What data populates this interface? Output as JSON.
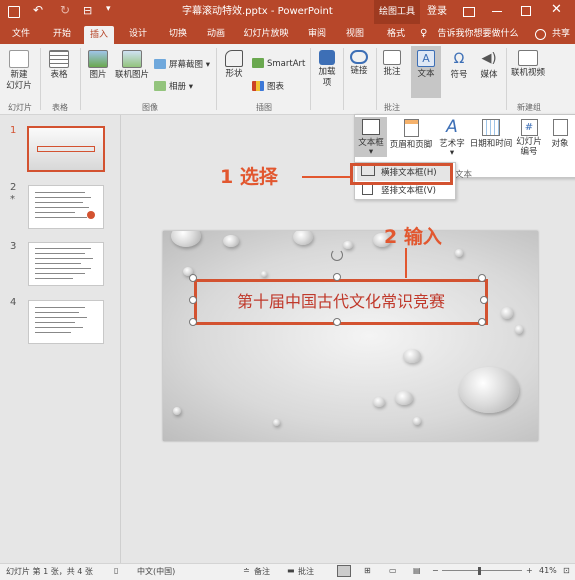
{
  "titlebar": {
    "doc_title": "字幕滚动特效.pptx - PowerPoint",
    "context_tab": "绘图工具",
    "login": "登录"
  },
  "tabs": {
    "file": "文件",
    "home": "开始",
    "insert": "插入",
    "design": "设计",
    "transitions": "切换",
    "animations": "动画",
    "slideshow": "幻灯片放映",
    "review": "审阅",
    "view": "视图",
    "format": "格式",
    "tellme": "告诉我你想要做什么",
    "share": "共享"
  },
  "ribbon": {
    "new_slide": "新建\n幻灯片",
    "table": "表格",
    "picture": "图片",
    "online_picture": "联机图片",
    "screenshot": "屏幕截图",
    "album": "相册",
    "shapes": "形状",
    "smartart": "SmartArt",
    "chart": "图表",
    "addins": "加载\n项",
    "link": "链接",
    "comment": "批注",
    "text": "文本",
    "symbols": "符号",
    "media": "媒体",
    "online_video": "联机视频",
    "groups": {
      "slides": "幻灯片",
      "tables": "表格",
      "images": "图像",
      "illustrations": "插图",
      "comments": "批注",
      "newgroup": "新建组"
    }
  },
  "text_menu": {
    "textbox": "文本框",
    "header_footer": "页眉和页脚",
    "wordart": "艺术字",
    "datetime": "日期和时间",
    "slide_number": "幻灯片\n编号",
    "object": "对象",
    "group_label": "文本"
  },
  "textbox_menu": {
    "horizontal": "横排文本框(H)",
    "vertical": "竖排文本框(V)"
  },
  "callouts": {
    "step1": "1 选择",
    "step2": "2 输入"
  },
  "slides": [
    {
      "number": "1"
    },
    {
      "number": "2",
      "marker": "*"
    },
    {
      "number": "3"
    },
    {
      "number": "4"
    }
  ],
  "slide": {
    "title": "第十届中国古代文化常识竞赛"
  },
  "statusbar": {
    "slide_info": "幻灯片 第 1 张，共 4 张",
    "language": "中文(中国)",
    "notes": "备注",
    "comments": "批注",
    "zoom": "41%"
  },
  "colors": {
    "accent": "#b7472a",
    "callout": "#e2572f"
  }
}
